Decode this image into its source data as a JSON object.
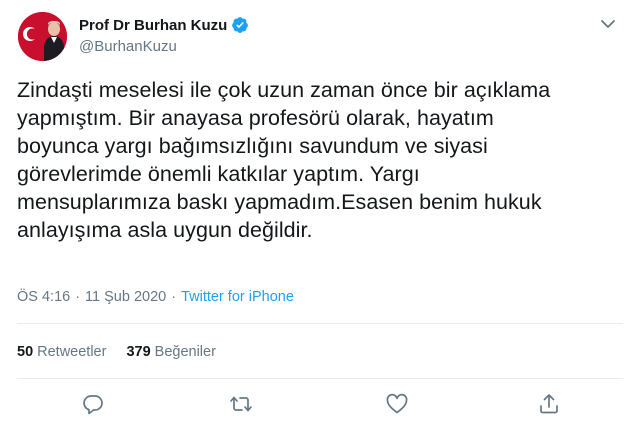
{
  "tweet": {
    "display_name": "Prof Dr Burhan Kuzu",
    "handle": "@BurhanKuzu",
    "text": "Zindaşti meselesi ile çok uzun zaman önce bir açıklama\nyapmıştım. Bir anayasa profesörü olarak, hayatım\nboyunca yargı bağımsızlığını savundum ve siyasi\ngörevlerimde önemli katkılar yaptım. Yargı\nmensuplarımıza baskı yapmadım.Esasen benim hukuk\nanlayışıma asla uygun değildir.",
    "time": "ÖS 4:16",
    "separator": "·",
    "date": "11 Şub 2020",
    "source": "Twitter for iPhone",
    "retweet_count": "50",
    "retweet_label": "Retweetler",
    "like_count": "379",
    "like_label": "Beğeniler"
  },
  "icons": {
    "verified": "verified-badge-icon",
    "caret": "chevron-down-icon",
    "reply": "reply-icon",
    "retweet": "retweet-icon",
    "like": "heart-icon",
    "share": "share-icon"
  },
  "colors": {
    "accent": "#1da1f2",
    "text": "#14171a",
    "secondary": "#657786",
    "divider": "#e6ecf0"
  }
}
